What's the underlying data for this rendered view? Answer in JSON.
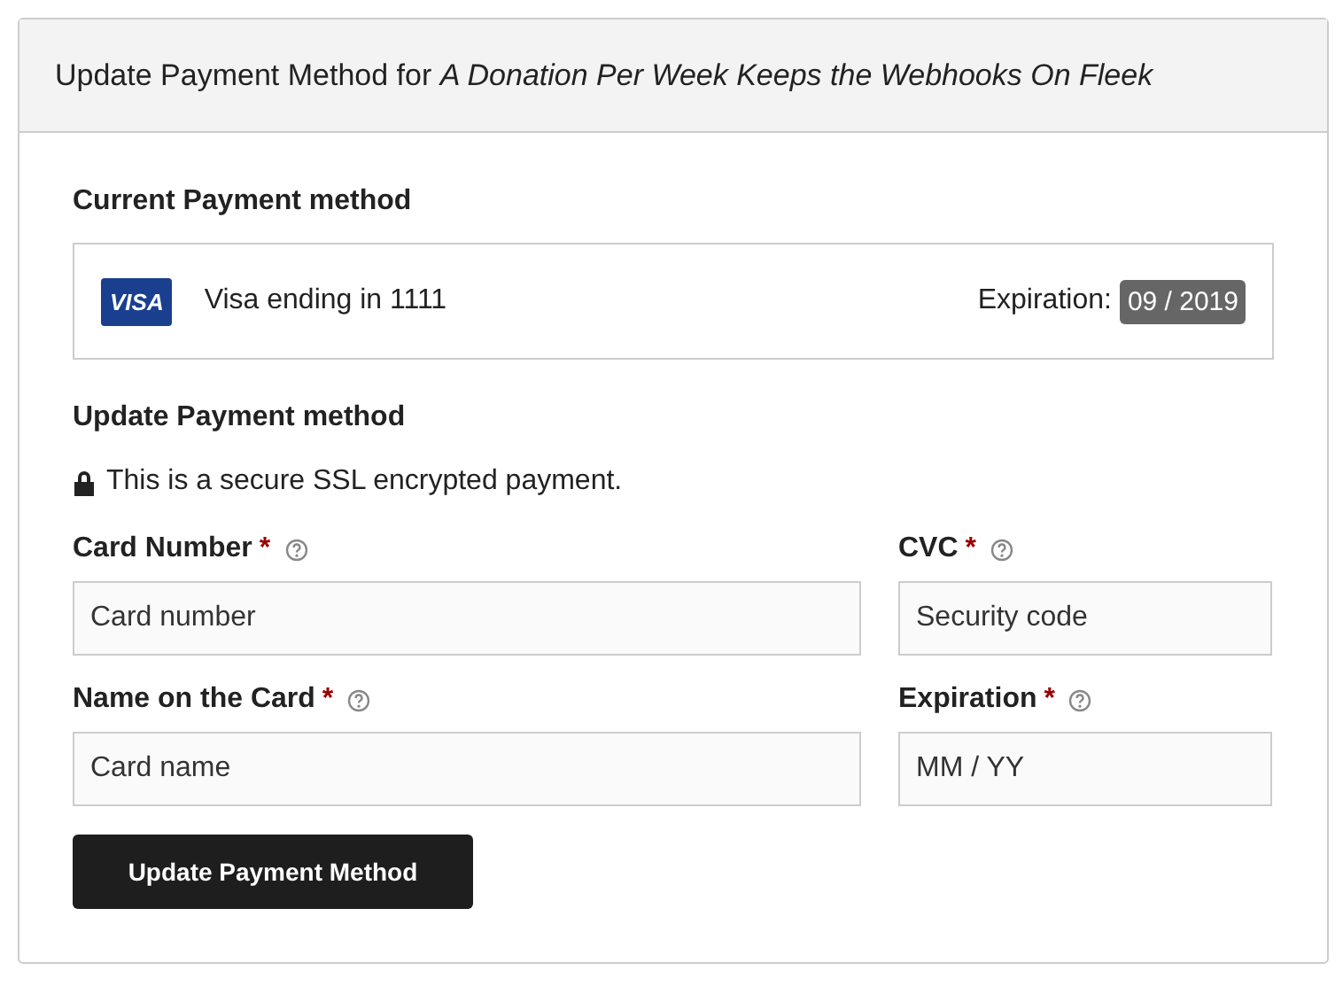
{
  "title": "Update Payment Method for *A Donation Per Week Keeps the Webhooks On Fleek*",
  "current": {
    "heading": "Current Payment method",
    "brand": "VISA",
    "description": "Visa ending in 1111",
    "expiration_label": "Expiration:",
    "expiration": "09 / 2019"
  },
  "update": {
    "heading": "Update Payment method",
    "secure_note": "This is a secure SSL encrypted payment."
  },
  "fields": [
    {
      "label": "Card Number",
      "required_mark": "*",
      "placeholder": "Card number"
    },
    {
      "label": "CVC",
      "required_mark": "*",
      "placeholder": "Security code"
    },
    {
      "label": "Name on the Card",
      "required_mark": "*",
      "placeholder": "Card name"
    },
    {
      "label": "Expiration",
      "required_mark": "*",
      "placeholder": "MM / YY"
    }
  ],
  "submit": "Update Payment Method"
}
